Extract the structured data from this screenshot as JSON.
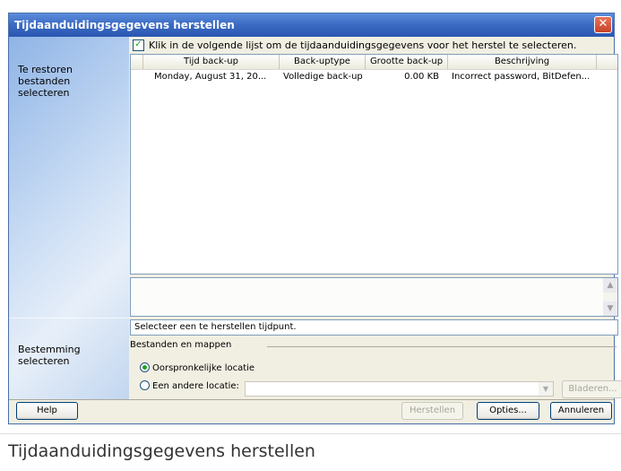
{
  "dialog": {
    "title": "Tijdaanduidingsgegevens herstellen",
    "close_glyph": "✕"
  },
  "sidebar": {
    "steps": [
      {
        "label": "Te restoren bestanden selecteren"
      },
      {
        "label": "Bestemming selecteren"
      }
    ]
  },
  "list": {
    "select_checkbox_label": "Klik in de volgende lijst om de tijdaanduidingsgegevens voor het herstel te selecteren.",
    "select_checked": true,
    "columns": [
      "Tijd back-up",
      "Back-uptype",
      "Grootte back-up",
      "Beschrijving"
    ],
    "rows": [
      {
        "time": "Monday, August 31, 20...",
        "type": "Volledige back-up",
        "size": "0.00 KB",
        "description": "Incorrect password, BitDefen..."
      }
    ]
  },
  "status": {
    "text": "Selecteer een te herstellen tijdpunt."
  },
  "destination": {
    "group_label": "Bestanden en mappen",
    "original_label": "Oorspronkelijke locatie",
    "other_label": "Een andere locatie:",
    "other_path": "",
    "browse_label": "Bladeren..."
  },
  "buttons": {
    "help": "Help",
    "restore": "Herstellen",
    "options": "Opties...",
    "cancel": "Annuleren"
  },
  "caption": "Tijdaanduidingsgegevens herstellen"
}
